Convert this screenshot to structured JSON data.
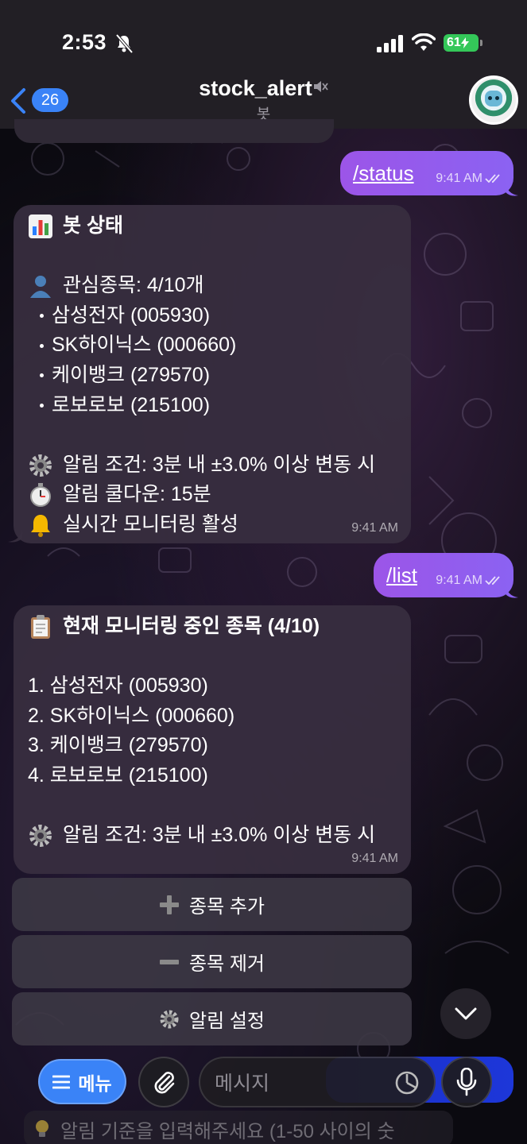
{
  "status_bar": {
    "time": "2:53",
    "battery": "61"
  },
  "header": {
    "back_count": "26",
    "title": "stock_alert",
    "subtitle": "봇"
  },
  "messages": {
    "out1": {
      "text": "/status",
      "time": "9:41 AM"
    },
    "status": {
      "title": "봇 상태",
      "watch_label": "관심종목: 4/10개",
      "stocks": [
        "삼성전자 (005930)",
        "SK하이닉스 (000660)",
        "케이뱅크 (279570)",
        "로보로보 (215100)"
      ],
      "alert_condition": "알림 조건: 3분 내 ±3.0% 이상 변동 시",
      "cooldown": "알림 쿨다운: 15분",
      "monitoring": "실시간 모니터링 활성",
      "time": "9:41 AM"
    },
    "out2": {
      "text": "/list",
      "time": "9:41 AM"
    },
    "list": {
      "title": "현재 모니터링 중인 종목 (4/10)",
      "items": [
        "1. 삼성전자 (005930)",
        "2. SK하이닉스 (000660)",
        "3. 케이뱅크 (279570)",
        "4. 로보로보 (215100)"
      ],
      "alert_condition": "알림 조건: 3분 내 ±3.0% 이상 변동 시",
      "time": "9:41 AM"
    }
  },
  "keyboard": {
    "add": "종목 추가",
    "remove": "종목 제거",
    "settings": "알림 설정"
  },
  "input": {
    "menu": "메뉴",
    "placeholder": "메시지"
  },
  "hint": "알림 기준을 입력해주세요 (1-50 사이의 숫"
}
